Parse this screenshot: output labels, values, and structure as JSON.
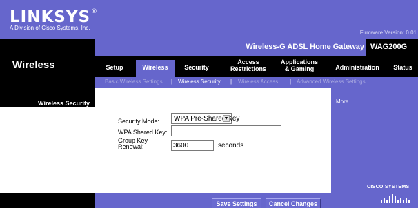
{
  "header": {
    "logo_text": "LINKSYS",
    "logo_reg": "®",
    "tagline": "A Division of Cisco Systems, Inc.",
    "firmware": "Firmware Version: 0.01"
  },
  "section_title": "Wireless",
  "product": {
    "name": "Wireless-G ADSL Home Gateway",
    "model": "WAG200G"
  },
  "tabs": [
    {
      "label": "Setup"
    },
    {
      "label": "Wireless",
      "active": true
    },
    {
      "label": "Security"
    },
    {
      "label": "Access\nRestrictions"
    },
    {
      "label": "Applications\n& Gaming"
    },
    {
      "label": "Administration"
    },
    {
      "label": "Status"
    }
  ],
  "subtabs": [
    {
      "label": "Basic Wireless Settings"
    },
    {
      "label": "Wireless Security",
      "active": true
    },
    {
      "label": "Wireless Access"
    },
    {
      "label": "Advanced Wireless Settings"
    }
  ],
  "sidebar": {
    "section_title": "Wireless Security"
  },
  "form": {
    "mode_label": "Security Mode:",
    "mode_value": "WPA Pre-Shared Key",
    "key_label": "WPA Shared Key:",
    "key_value": "",
    "renewal_label": "Group Key\nRenewal:",
    "renewal_value": "3600",
    "renewal_unit": "seconds"
  },
  "help": {
    "more_label": "More..."
  },
  "footer": {
    "save_label": "Save Settings",
    "cancel_label": "Cancel Changes"
  },
  "cisco": {
    "name": "CISCO SYSTEMS"
  },
  "colors": {
    "brand_purple": "#6666cc",
    "band_black": "#000000",
    "subtab_inactive": "#a9a9e0",
    "divider": "#c6c6ee"
  }
}
